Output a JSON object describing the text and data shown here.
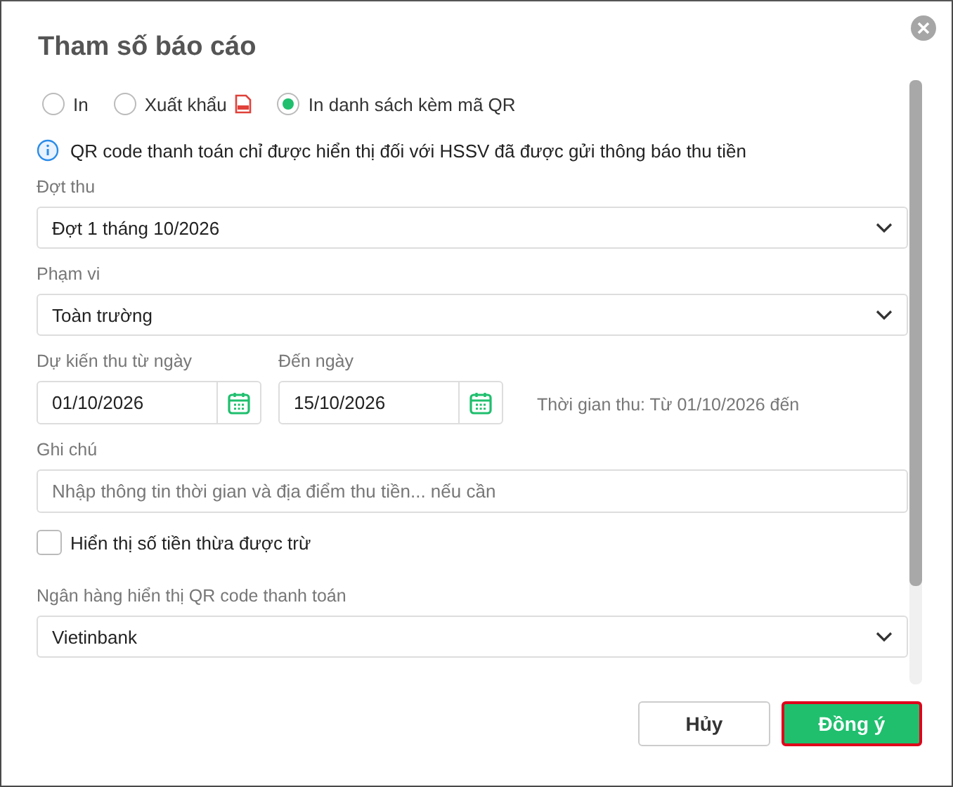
{
  "dialog": {
    "title": "Tham số báo cáo"
  },
  "modes": [
    {
      "label": "In",
      "selected": false,
      "kind": "plain"
    },
    {
      "label": "Xuất khẩu",
      "selected": false,
      "kind": "pdf"
    },
    {
      "label": "In danh sách kèm mã QR",
      "selected": true,
      "kind": "plain"
    }
  ],
  "notice": "QR code thanh toán chỉ được hiển thị đối với HSSV đã được gửi thông báo thu tiền",
  "collection_round": {
    "label": "Đợt thu",
    "value": "Đợt 1 tháng 10/2026"
  },
  "scope": {
    "label": "Phạm vi",
    "value": "Toàn trường"
  },
  "from_date": {
    "label": "Dự kiến thu từ ngày",
    "value": "01/10/2026"
  },
  "to_date": {
    "label": "Đến ngày",
    "value": "15/10/2026"
  },
  "period_note": "Thời gian thu: Từ 01/10/2026 đến",
  "note": {
    "label": "Ghi chú",
    "placeholder": "Nhập thông tin thời gian và địa điểm thu tiền... nếu cần"
  },
  "show_excess": {
    "label": "Hiển thị số tiền thừa được trừ",
    "checked": false
  },
  "bank": {
    "label": "Ngân hàng hiển thị QR code thanh toán",
    "value": "Vietinbank"
  },
  "buttons": [
    {
      "label": "Hủy",
      "kind": "secondary"
    },
    {
      "label": "Đồng ý",
      "kind": "primary"
    }
  ]
}
